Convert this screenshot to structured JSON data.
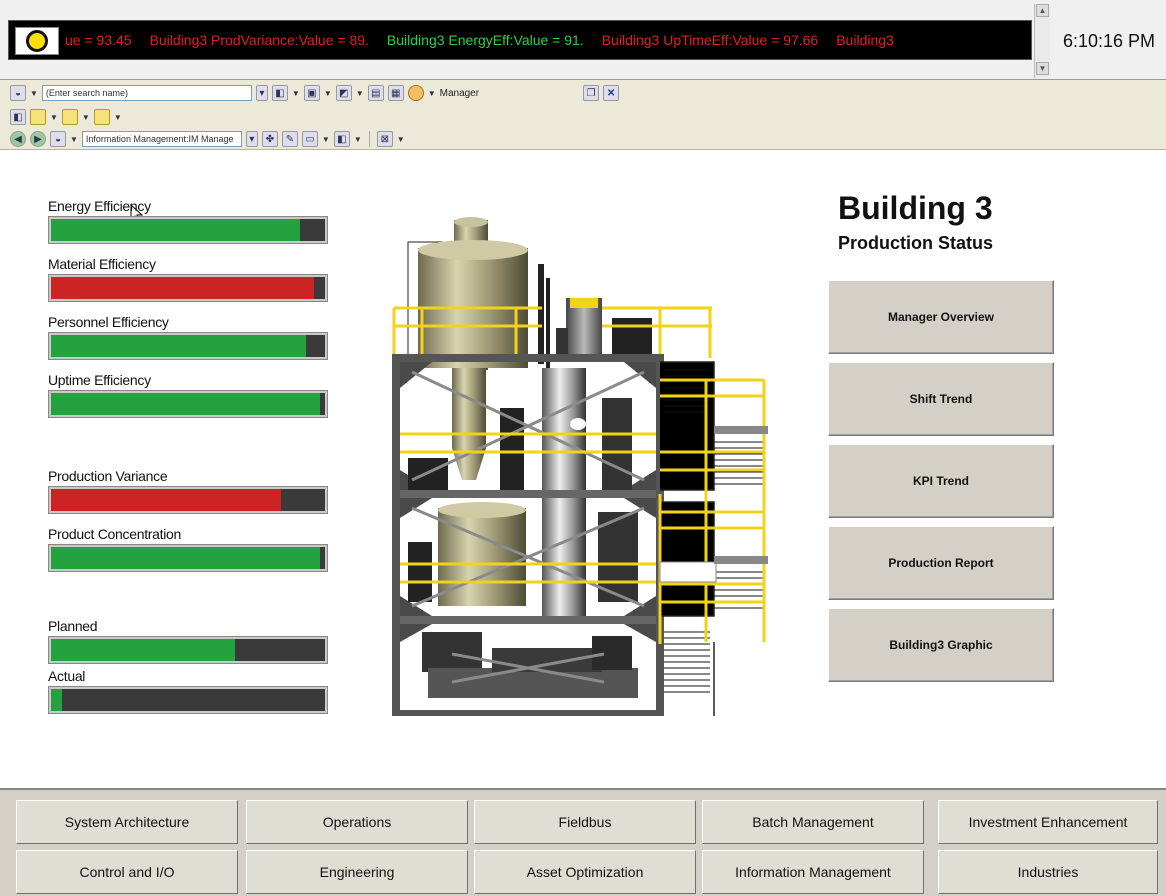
{
  "ticker": {
    "items": [
      {
        "text": "ue = 93.45",
        "color": "red"
      },
      {
        "text": "Building3 ProdVariance:Value = 89.",
        "color": "red"
      },
      {
        "text": "Building3 EnergyEff:Value = 91.",
        "color": "green"
      },
      {
        "text": "Building3 UpTimeEff:Value = 97.66",
        "color": "red"
      },
      {
        "text": "Building3",
        "color": "red"
      }
    ],
    "indicator_icon": "status-light-icon"
  },
  "clock": "6:10:16 PM",
  "toolbar": {
    "search_placeholder": "(Enter search name)",
    "manager_label": "Manager",
    "path_value": "Information Management:IM Manage"
  },
  "kpis": [
    {
      "label": "Energy Efficiency",
      "fraction": 0.91,
      "status": "green"
    },
    {
      "label": "Material Efficiency",
      "fraction": 0.96,
      "status": "red"
    },
    {
      "label": "Personnel Efficiency",
      "fraction": 0.93,
      "status": "green"
    },
    {
      "label": "Uptime Efficiency",
      "fraction": 0.98,
      "status": "green"
    },
    {
      "label": "Production Variance",
      "fraction": 0.84,
      "status": "red"
    },
    {
      "label": "Product Concentration",
      "fraction": 0.98,
      "status": "green"
    },
    {
      "label": "Planned",
      "fraction": 0.67,
      "status": "green"
    },
    {
      "label": "Actual",
      "fraction": 0.04,
      "status": "green"
    }
  ],
  "header": {
    "title": "Building 3",
    "subtitle": "Production Status"
  },
  "nav_buttons": [
    "Manager Overview",
    "Shift Trend",
    "KPI Trend",
    "Production Report",
    "Building3 Graphic"
  ],
  "bottom_nav": [
    [
      "System Architecture",
      "Operations",
      "Fieldbus",
      "Batch Management",
      "Investment Enhancement"
    ],
    [
      "Control and I/O",
      "Engineering",
      "Asset Optimization",
      "Information Management",
      "Industries"
    ]
  ],
  "colors": {
    "status_green": "#23a23f",
    "status_red": "#cc2424",
    "ticker_red": "#e02020",
    "ticker_green": "#2fd04a",
    "railing_yellow": "#f2d21a"
  }
}
